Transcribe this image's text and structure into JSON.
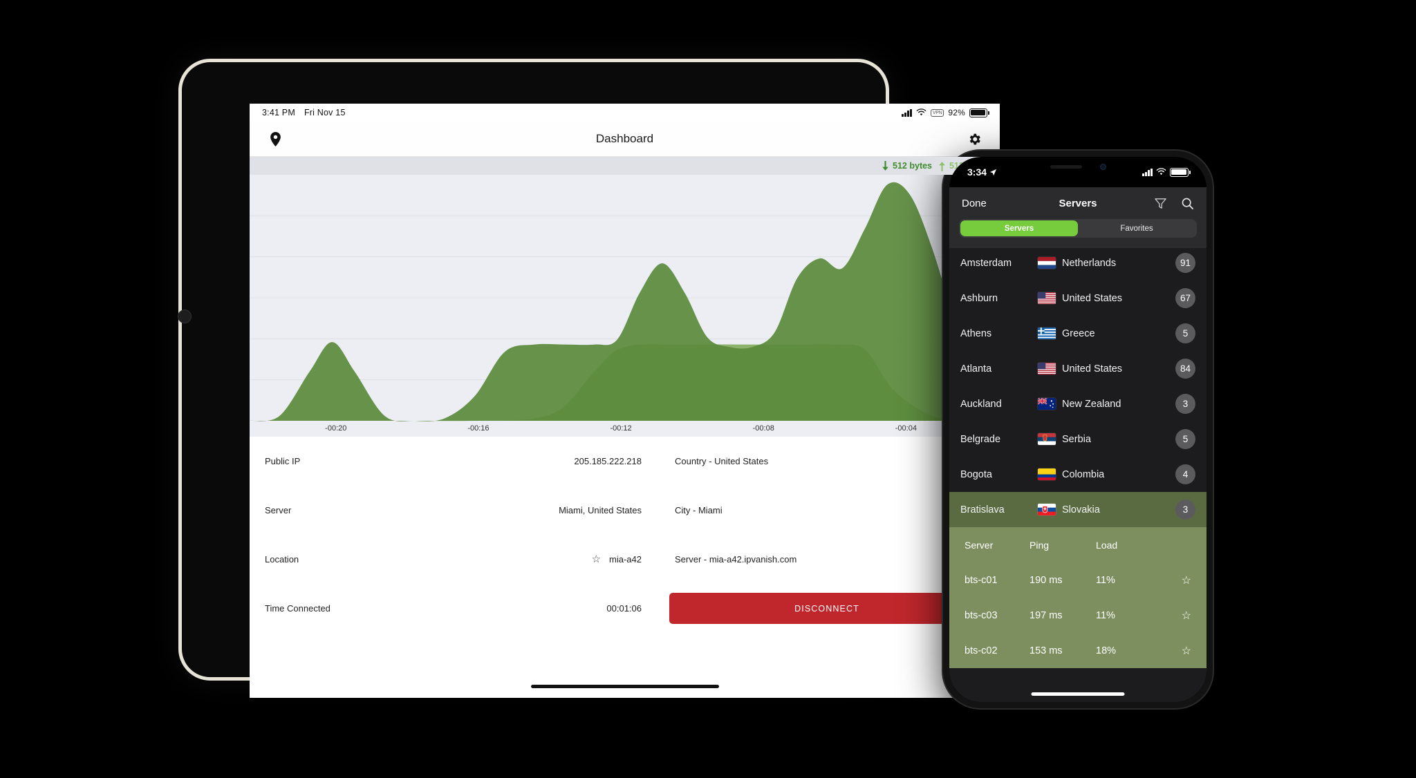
{
  "tablet": {
    "status_bar": {
      "time": "3:41 PM",
      "date": "Fri Nov 15",
      "battery_percent": "92%",
      "battery_chip_label": "VPN"
    },
    "navbar": {
      "location_icon": "location-pin-icon",
      "title": "Dashboard",
      "settings_icon": "gear-icon"
    },
    "chart_header": {
      "download_label": "512 bytes",
      "upload_label": "512 bytes",
      "download_arrow": "↓",
      "upload_arrow": "↑"
    },
    "rows": [
      {
        "label": "Public IP",
        "value": "205.185.222.218",
        "extra": "Country - United States"
      },
      {
        "label": "Server",
        "value": "Miami, United States",
        "extra": "City - Miami"
      },
      {
        "label": "Location",
        "value": "mia-a42",
        "star": "☆",
        "extra": "Server - mia-a42.ipvanish.com"
      },
      {
        "label": "Time Connected",
        "value": "00:01:06",
        "extra": "DISCONNECT"
      }
    ],
    "disconnect_label": "DISCONNECT",
    "colors": {
      "disconnect_red": "#c0272d",
      "download_green": "#5a8a3c",
      "upload_green": "#8cb26b",
      "chart_bg": "#eceef3"
    }
  },
  "chart_data": {
    "type": "area",
    "title": "",
    "xlabel": "",
    "ylabel": "",
    "x_tick_labels": [
      "-00:20",
      "-00:16",
      "-00:12",
      "-00:08",
      "-00:04"
    ],
    "x_tick_positions_pct": [
      11.5,
      30.5,
      49.5,
      68.5,
      87.5
    ],
    "xlim": [
      "-00:22",
      "-00:02"
    ],
    "ylim": [
      0,
      100
    ],
    "grid": true,
    "legend_position": "top-right",
    "series": [
      {
        "name": "Download",
        "label": "512 bytes",
        "color": "#5a8a3c",
        "x": [
          0,
          4,
          8,
          11,
          14,
          18,
          22,
          26,
          30,
          34,
          38,
          42,
          46,
          49,
          52,
          55,
          58,
          61,
          64,
          67,
          70,
          73,
          76,
          79,
          82,
          85,
          88,
          91,
          94,
          97,
          100
        ],
        "values": [
          0,
          2,
          20,
          32,
          20,
          2,
          0,
          1,
          10,
          28,
          31,
          31,
          31,
          33,
          52,
          64,
          52,
          34,
          30,
          30,
          36,
          58,
          66,
          62,
          78,
          96,
          92,
          70,
          40,
          14,
          4
        ]
      },
      {
        "name": "Upload",
        "label": "512 bytes",
        "color": "#8cb26b",
        "x": [
          0,
          10,
          20,
          30,
          38,
          42,
          46,
          50,
          58,
          66,
          70,
          74,
          78,
          82,
          86,
          92,
          100
        ],
        "values": [
          0,
          0,
          0,
          0,
          1,
          6,
          20,
          30,
          31,
          31,
          31,
          31,
          31,
          29,
          12,
          1,
          0
        ]
      }
    ]
  },
  "phone": {
    "status_bar": {
      "time": "3:34",
      "location_arrow": "➤"
    },
    "navbar": {
      "done_label": "Done",
      "title": "Servers",
      "filter_icon": "filter-icon",
      "search_icon": "search-icon"
    },
    "segmented": {
      "options": [
        "Servers",
        "Favorites"
      ],
      "active": "Servers",
      "active_color": "#76cc3d"
    },
    "servers": [
      {
        "city": "Amsterdam",
        "country": "Netherlands",
        "count": "91",
        "flag": "nl",
        "selected": false
      },
      {
        "city": "Ashburn",
        "country": "United States",
        "count": "67",
        "flag": "us",
        "selected": false
      },
      {
        "city": "Athens",
        "country": "Greece",
        "count": "5",
        "flag": "gr",
        "selected": false
      },
      {
        "city": "Atlanta",
        "country": "United States",
        "count": "84",
        "flag": "us",
        "selected": false
      },
      {
        "city": "Auckland",
        "country": "New Zealand",
        "count": "3",
        "flag": "nz",
        "selected": false
      },
      {
        "city": "Belgrade",
        "country": "Serbia",
        "count": "5",
        "flag": "rs",
        "selected": false
      },
      {
        "city": "Bogota",
        "country": "Colombia",
        "count": "4",
        "flag": "co",
        "selected": false
      },
      {
        "city": "Bratislava",
        "country": "Slovakia",
        "count": "3",
        "flag": "sk",
        "selected": true
      }
    ],
    "detail": {
      "headers": {
        "server": "Server",
        "ping": "Ping",
        "load": "Load"
      },
      "rows": [
        {
          "server": "bts-c01",
          "ping": "190 ms",
          "load": "11%",
          "star": "☆"
        },
        {
          "server": "bts-c03",
          "ping": "197 ms",
          "load": "11%",
          "star": "☆"
        },
        {
          "server": "bts-c02",
          "ping": "153 ms",
          "load": "18%",
          "star": "☆"
        }
      ]
    }
  }
}
